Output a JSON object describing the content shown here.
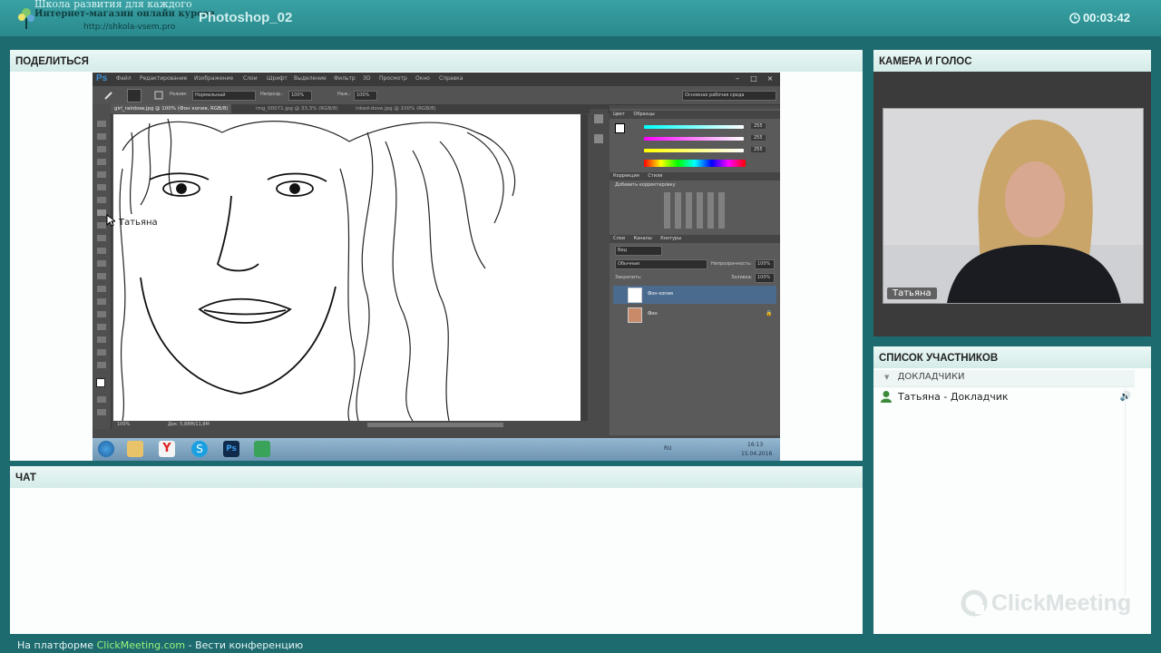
{
  "header": {
    "logo_line1": "Школа развития для каждого",
    "logo_line2": "Интернет-магазин онлайн курсов",
    "logo_url": "http://shkola-vsem.pro",
    "title": "Photoshop_02",
    "timer": "00:03:42"
  },
  "share": {
    "title": "ПОДЕЛИТЬСЯ",
    "cursor_label": "Татьяна",
    "photoshop": {
      "menu": [
        "Файл",
        "Редактирование",
        "Изображение",
        "Слои",
        "Шрифт",
        "Выделение",
        "Фильтр",
        "3D",
        "Просмотр",
        "Окно",
        "Справка"
      ],
      "options": {
        "mode_label": "Режим:",
        "mode_value": "Нормальный",
        "opacity_label": "Непрозр.:",
        "opacity_value": "100%",
        "press_label": "Наж.:",
        "press_value": "100%",
        "workspace": "Основная рабочая среда"
      },
      "tabs": [
        "girl_rainbow.jpg @ 100% (Фон копия, RGB/8)",
        "img_00071.jpg @ 33,3% (RGB/8)",
        "inked-dove.jpg @ 100% (RGB/8)"
      ],
      "status_zoom": "100%",
      "status_doc": "Док: 5,88М/11,8М",
      "panels": {
        "color_tab": "Цвет",
        "swatches_tab": "Образцы",
        "r": "255",
        "g": "255",
        "b": "255",
        "adjust_tab": "Коррекция",
        "styles_tab": "Стили",
        "adjust_title": "Добавить корректировку",
        "layers_tab": "Слои",
        "channels_tab": "Каналы",
        "paths_tab": "Контуры",
        "kind": "Вид",
        "blend": "Обычные",
        "opacity_label": "Непрозрачность:",
        "opacity": "100%",
        "lock_label": "Закрепить:",
        "fill_label": "Заливка:",
        "fill": "100%",
        "layers": [
          "Фон копия",
          "Фон"
        ]
      },
      "taskbar": {
        "lang": "RU",
        "time": "16:13",
        "date": "15.04.2016"
      }
    }
  },
  "chat": {
    "title": "ЧАТ"
  },
  "camera": {
    "title": "КАМЕРА И ГОЛОС",
    "name": "Татьяна"
  },
  "participants": {
    "title": "СПИСОК УЧАСТНИКОВ",
    "group": "ДОКЛАДЧИКИ",
    "users": [
      {
        "name": "Татьяна - Докладчик"
      }
    ]
  },
  "brand": "ClickMeeting",
  "footer": {
    "prefix": "На платформе",
    "link": "ClickMeeting.com",
    "suffix": "- Вести конференцию"
  }
}
